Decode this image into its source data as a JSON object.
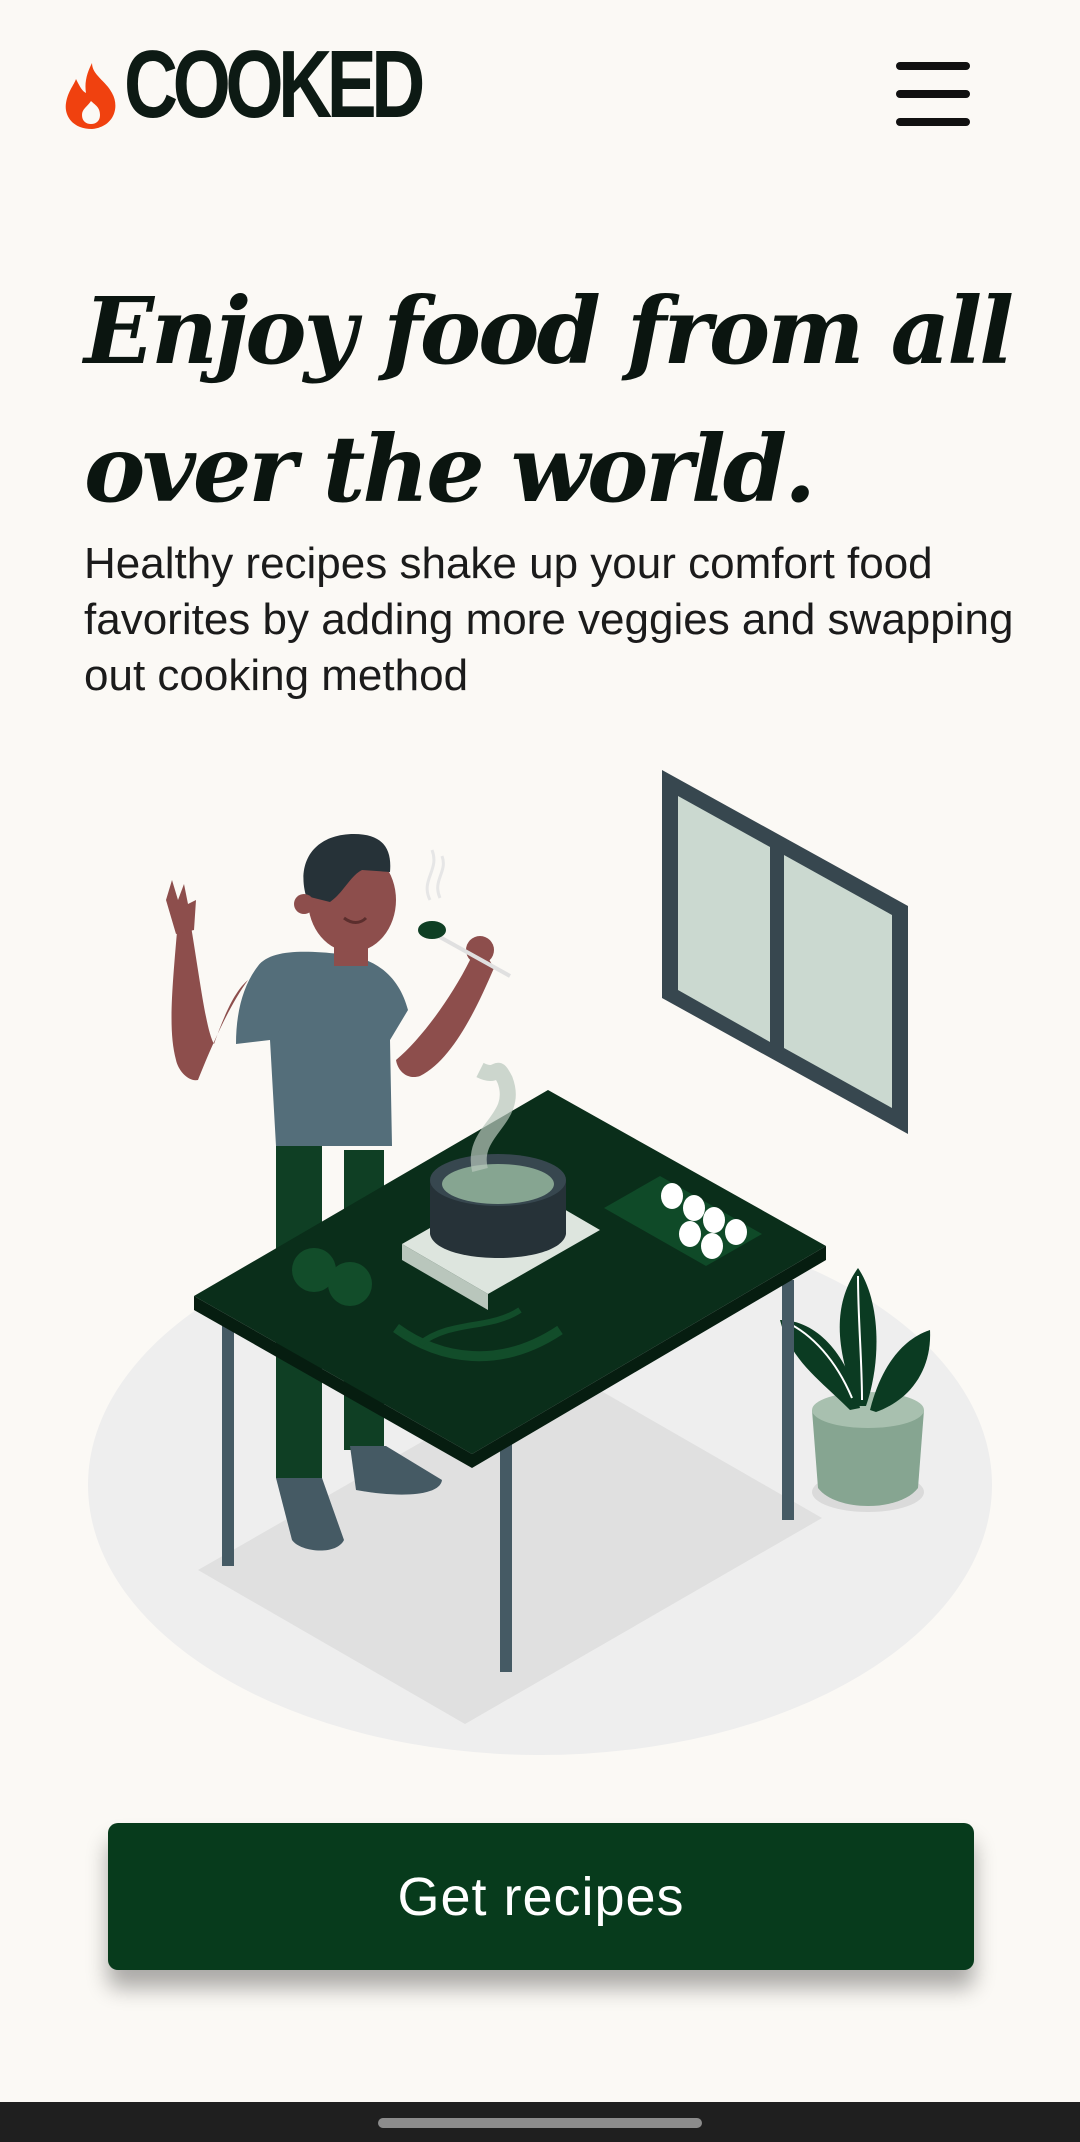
{
  "header": {
    "logo_text": "COOKED",
    "logo_icon": "flame-icon",
    "menu_icon": "hamburger-menu-icon"
  },
  "hero": {
    "title": "Enjoy food from all over the world.",
    "subtitle": "Healthy recipes shake up your comfort food favorites by adding more veggies and swapping out cooking method"
  },
  "illustration": {
    "icon": "man-cooking-illustration"
  },
  "cta": {
    "label": "Get recipes"
  },
  "colors": {
    "background": "#FBF9F5",
    "brand_green": "#073B1C",
    "flame_orange": "#F0410F",
    "text_dark": "#0B1510"
  }
}
